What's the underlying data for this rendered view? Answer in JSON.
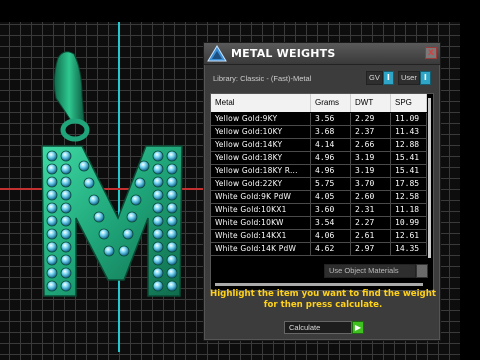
{
  "dialog": {
    "title": "METAL WEIGHTS",
    "close_glyph": "x",
    "library_label": "Library: Classic - (Fast)-Metal",
    "toggles": [
      {
        "label": "GV",
        "state": "I"
      },
      {
        "label": "User",
        "state": "I"
      }
    ],
    "table": {
      "headers": [
        "Metal",
        "Grams",
        "DWT",
        "SPG"
      ],
      "rows": [
        [
          "Yellow Gold:9KY",
          "3.56",
          "2.29",
          "11.09"
        ],
        [
          "Yellow Gold:10KY",
          "3.68",
          "2.37",
          "11.43"
        ],
        [
          "Yellow Gold:14KY",
          "4.14",
          "2.66",
          "12.88"
        ],
        [
          "Yellow Gold:18KY",
          "4.96",
          "3.19",
          "15.41"
        ],
        [
          "Yellow Gold:18KY R...",
          "4.96",
          "3.19",
          "15.41"
        ],
        [
          "Yellow Gold:22KY",
          "5.75",
          "3.70",
          "17.85"
        ],
        [
          "White Gold:9K PdW",
          "4.05",
          "2.60",
          "12.58"
        ],
        [
          "White Gold:10KX1",
          "3.60",
          "2.31",
          "11.18"
        ],
        [
          "White Gold:10KW",
          "3.54",
          "2.27",
          "10.99"
        ],
        [
          "White Gold:14KX1",
          "4.06",
          "2.61",
          "12.61"
        ],
        [
          "White Gold:14K PdW",
          "4.62",
          "2.97",
          "14.35"
        ]
      ]
    },
    "use_object_materials_label": "Use Object Materials",
    "instructions": "Highlight the item you want to find the weight for then press calculate.",
    "calculate_label": "Calculate",
    "calculate_glyph": "▶"
  },
  "colors": {
    "accent_yellow": "#ffd21a",
    "toggle_blue": "#2fa6c7",
    "go_green": "#3fc21f",
    "metal_green": "#1fa579",
    "axis_cyan": "#26c9cf",
    "axis_red": "#c43030"
  },
  "icons": {
    "logo": "rhino-jewel-logo-icon",
    "close": "close-icon",
    "calculate": "play-arrow-icon"
  }
}
